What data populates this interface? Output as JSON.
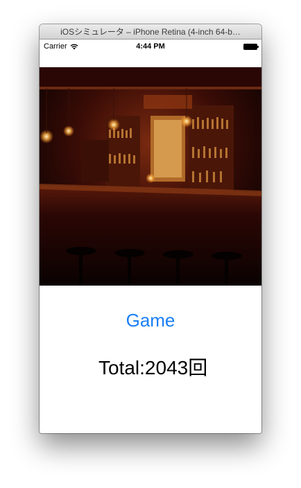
{
  "window": {
    "title": "iOSシミュレータ – iPhone Retina (4-inch 64-b…"
  },
  "status_bar": {
    "carrier": "Carrier",
    "time": "4:44 PM"
  },
  "main": {
    "game_button_label": "Game",
    "total_label": "Total:2043回"
  },
  "colors": {
    "link_blue": "#1a7ef5"
  }
}
